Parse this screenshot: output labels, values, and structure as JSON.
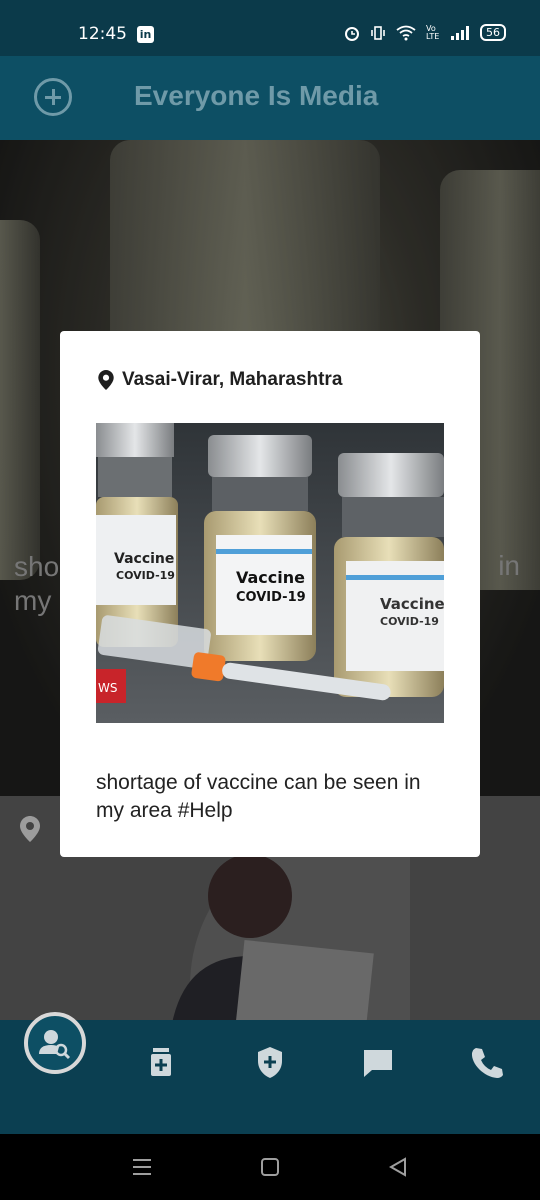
{
  "status_bar": {
    "time": "12:45",
    "linkedin_badge": "in",
    "network_label": "Vo LTE",
    "battery": "56"
  },
  "app_bar": {
    "title": "Everyone Is Media",
    "add_icon": "plus-circle-icon"
  },
  "background_post": {
    "caption_left": "sho\nmy",
    "caption_right": "in"
  },
  "dialog": {
    "location": "Vasai-Virar, Maharashtra",
    "location_icon": "location-pin-icon",
    "image_labels": {
      "vial_main_line1": "Vaccine",
      "vial_main_line2": "COVID-19",
      "vial_left_line1": "Vaccine",
      "vial_left_line2": "COVID-19",
      "vial_right_line1": "Vaccine",
      "vial_right_line2": "COVID-19",
      "corner_tag": "WS"
    },
    "caption": "shortage of vaccine can be seen in my area  #Help"
  },
  "bottom_nav": {
    "items": [
      {
        "name": "user-search-icon"
      },
      {
        "name": "medicine-icon"
      },
      {
        "name": "shield-plus-icon"
      },
      {
        "name": "chat-icon"
      },
      {
        "name": "phone-icon"
      }
    ]
  },
  "colors": {
    "appbar": "#0d4f64",
    "status_bar": "#0b3a4a",
    "title": "#6f9aa8",
    "nav_icons": "#cfd8dc"
  }
}
